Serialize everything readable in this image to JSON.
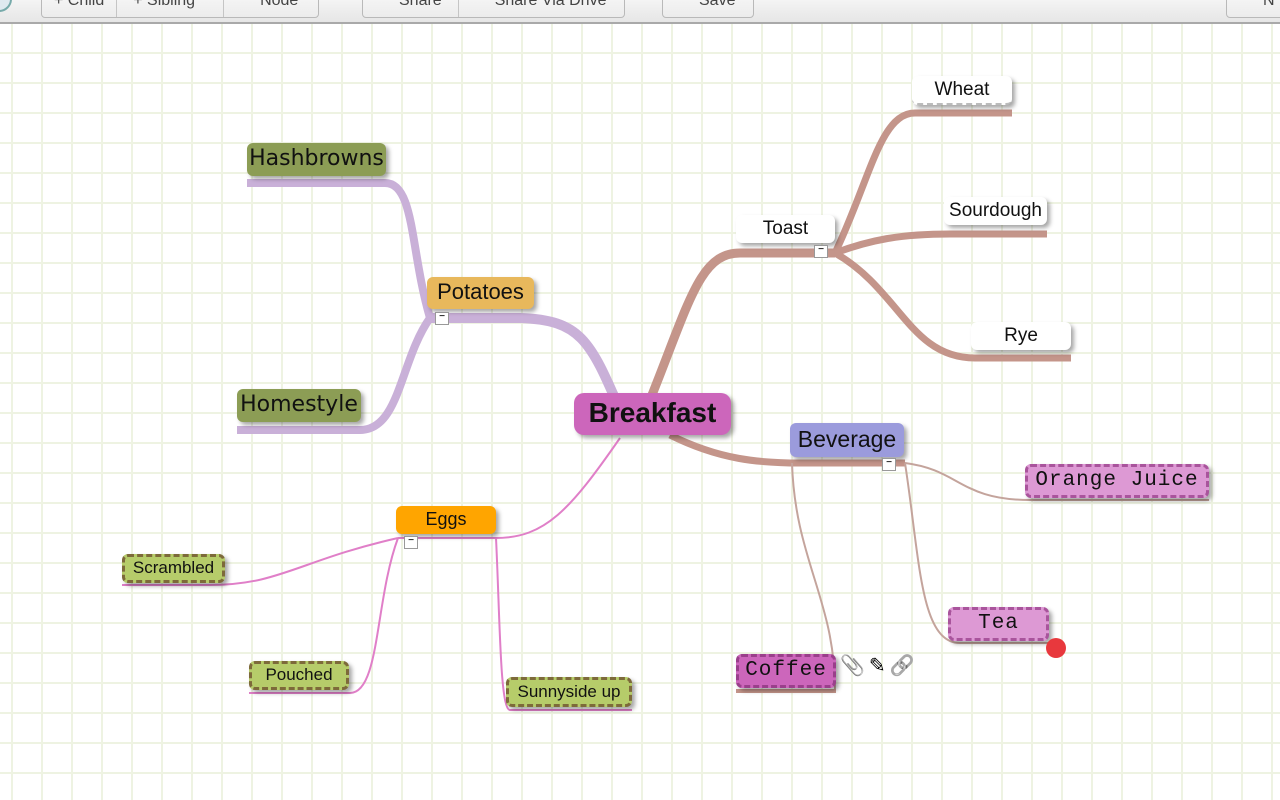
{
  "toolbar": {
    "groups": [
      {
        "buttons": [
          {
            "label": "+ Child"
          },
          {
            "label": "+ Sibling"
          },
          {
            "label": "Node"
          }
        ]
      },
      {
        "buttons": [
          {
            "label": "Share"
          },
          {
            "label": "Share Via Drive"
          }
        ]
      },
      {
        "buttons": [
          {
            "label": "Save"
          }
        ]
      },
      {
        "buttons": [
          {
            "label": "N"
          }
        ]
      }
    ]
  },
  "mindmap": {
    "root": {
      "label": "Breakfast",
      "color": "#cc66bb"
    },
    "branches": {
      "potatoes": {
        "label": "Potatoes",
        "color": "#e8b85c",
        "line_color": "#c9b0d8",
        "children": [
          {
            "label": "Hashbrowns",
            "color": "#8c9d55"
          },
          {
            "label": "Homestyle",
            "color": "#8c9d55"
          }
        ]
      },
      "toast": {
        "label": "Toast",
        "color": "#ffffff",
        "line_color": "#c4958a",
        "children": [
          {
            "label": "Wheat"
          },
          {
            "label": "Sourdough"
          },
          {
            "label": "Rye"
          }
        ]
      },
      "beverage": {
        "label": "Beverage",
        "color": "#9b9bdc",
        "line_color": "#c4a49c",
        "children": [
          {
            "label": "Orange Juice",
            "color": "#dd99d4"
          },
          {
            "label": "Tea",
            "color": "#dd99d4"
          },
          {
            "label": "Coffee",
            "color": "#cc66bb"
          }
        ]
      },
      "eggs": {
        "label": "Eggs",
        "color": "#ffa500",
        "line_color": "#e07fc8",
        "children": [
          {
            "label": "Scrambled",
            "color": "#b6cc6a"
          },
          {
            "label": "Pouched",
            "color": "#b6cc6a"
          },
          {
            "label": "Sunnyside up",
            "color": "#b6cc6a"
          }
        ]
      }
    },
    "collapse_symbol": "−",
    "node_icons": [
      {
        "name": "attachment",
        "glyph": "📎"
      },
      {
        "name": "edit",
        "glyph": "✎"
      },
      {
        "name": "link",
        "glyph": "🔗"
      }
    ]
  }
}
